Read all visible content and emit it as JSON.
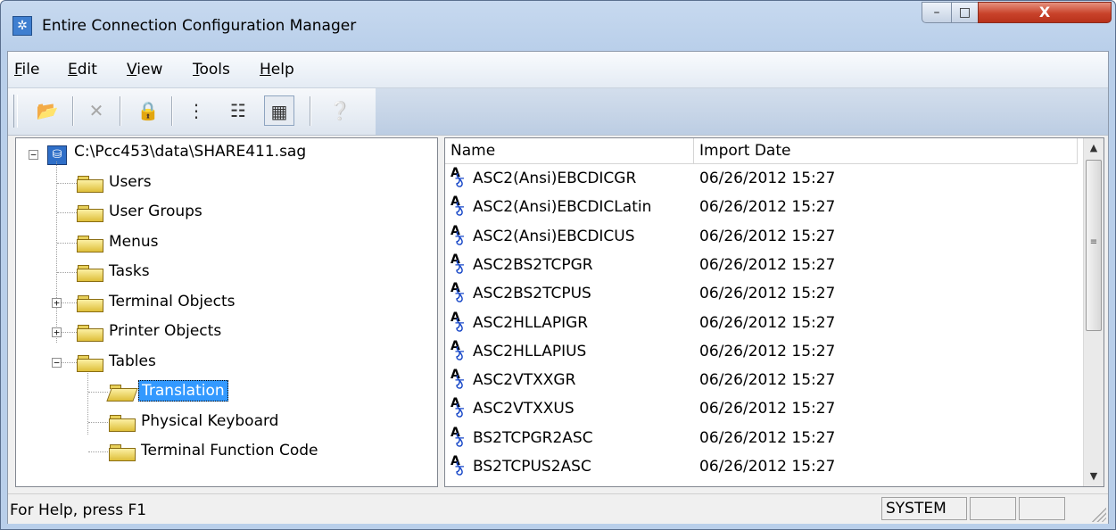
{
  "window": {
    "title": "Entire Connection Configuration Manager",
    "controls": {
      "minimize": "–",
      "maximize": "□",
      "close": "X"
    }
  },
  "menubar": [
    {
      "label": "File",
      "key": "F",
      "rest": "ile"
    },
    {
      "label": "Edit",
      "key": "E",
      "rest": "dit"
    },
    {
      "label": "View",
      "key": "V",
      "rest": "iew"
    },
    {
      "label": "Tools",
      "key": "T",
      "rest": "ools"
    },
    {
      "label": "Help",
      "key": "H",
      "rest": "elp"
    }
  ],
  "toolbar": [
    {
      "name": "open-button",
      "icon": "open-folder-icon",
      "glyph": "📂",
      "enabled": true
    },
    {
      "name": "delete-button",
      "icon": "delete-x-icon",
      "glyph": "✕",
      "enabled": false
    },
    {
      "name": "lock-button",
      "icon": "lock-icon",
      "glyph": "🔒",
      "enabled": false
    },
    {
      "name": "view-tree-button",
      "icon": "tree-view-icon",
      "glyph": "⋮",
      "enabled": true
    },
    {
      "name": "view-list-button",
      "icon": "list-view-icon",
      "glyph": "☷",
      "enabled": true
    },
    {
      "name": "view-details-button",
      "icon": "details-view-icon",
      "glyph": "▦",
      "enabled": true,
      "active": true
    },
    {
      "name": "context-help-button",
      "icon": "help-pointer-icon",
      "glyph": "❔",
      "enabled": true
    }
  ],
  "tree": {
    "root": "C:\\Pcc453\\data\\SHARE411.sag",
    "items": [
      {
        "label": "Users",
        "expander": ""
      },
      {
        "label": "User Groups",
        "expander": ""
      },
      {
        "label": "Menus",
        "expander": ""
      },
      {
        "label": "Tasks",
        "expander": ""
      },
      {
        "label": "Terminal Objects",
        "expander": "+"
      },
      {
        "label": "Printer Objects",
        "expander": "+"
      },
      {
        "label": "Tables",
        "expander": "−"
      }
    ],
    "children": [
      {
        "label": "Translation",
        "selected": true
      },
      {
        "label": "Physical Keyboard",
        "selected": false
      },
      {
        "label": "Terminal Function Code",
        "selected": false
      }
    ]
  },
  "list": {
    "columns": [
      "Name",
      "Import Date"
    ],
    "rows": [
      {
        "name": "ASC2(Ansi)EBCDICGR",
        "date": "06/26/2012 15:27"
      },
      {
        "name": "ASC2(Ansi)EBCDICLatin",
        "date": "06/26/2012 15:27"
      },
      {
        "name": "ASC2(Ansi)EBCDICUS",
        "date": "06/26/2012 15:27"
      },
      {
        "name": "ASC2BS2TCPGR",
        "date": "06/26/2012 15:27"
      },
      {
        "name": "ASC2BS2TCPUS",
        "date": "06/26/2012 15:27"
      },
      {
        "name": "ASC2HLLAPIGR",
        "date": "06/26/2012 15:27"
      },
      {
        "name": "ASC2HLLAPIUS",
        "date": "06/26/2012 15:27"
      },
      {
        "name": "ASC2VTXXGR",
        "date": "06/26/2012 15:27"
      },
      {
        "name": "ASC2VTXXUS",
        "date": "06/26/2012 15:27"
      },
      {
        "name": "BS2TCPGR2ASC",
        "date": "06/26/2012 15:27"
      },
      {
        "name": "BS2TCPUS2ASC",
        "date": "06/26/2012 15:27"
      }
    ],
    "row_icon": {
      "a": "A",
      "b": "ঠ"
    }
  },
  "statusbar": {
    "text": "For Help, press F1",
    "panels": [
      "SYSTEM",
      "",
      ""
    ]
  }
}
